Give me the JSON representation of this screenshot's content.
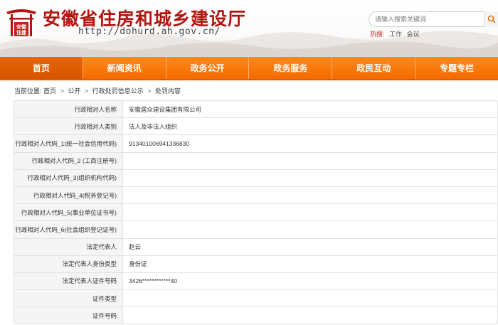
{
  "header": {
    "logo_text": "安徽住建",
    "title": "安徽省住房和城乡建设厅",
    "url": "http://dohurd.ah.gov.cn/",
    "search_placeholder": "请输入搜索关键词",
    "hot_label": "热搜:",
    "hot_words": [
      "工作",
      "会议"
    ]
  },
  "nav": {
    "items": [
      "首页",
      "新闻资讯",
      "政务公开",
      "政务服务",
      "政民互动",
      "专题专栏"
    ],
    "active_index": 0
  },
  "breadcrumb": {
    "prefix": "当前位置:",
    "items": [
      "首页",
      "公开",
      "行政处罚信息公示",
      "处罚内容"
    ],
    "separator": ">"
  },
  "table": {
    "rows": [
      {
        "label": "行政相对人名称",
        "value": "安徽居众建设集团有限公司"
      },
      {
        "label": "行政相对人类别",
        "value": "法人及非法人组织"
      },
      {
        "label": "行政相对人代码_1(统一社会信用代码)",
        "value": "913401006941336830"
      },
      {
        "label": "行政相对人代码_2 (工商注册号)",
        "value": ""
      },
      {
        "label": "行政相对人代码_3(组织机构代码)",
        "value": ""
      },
      {
        "label": "行政相对人代码_4(税务登记号)",
        "value": ""
      },
      {
        "label": "行政相对人代码_5(事业单位证书号)",
        "value": ""
      },
      {
        "label": "行政相对人代码_6(社会组织登记证号)",
        "value": ""
      },
      {
        "label": "法定代表人",
        "value": "赵云"
      },
      {
        "label": "法定代表人身份类型",
        "value": "身份证"
      },
      {
        "label": "法定代表人证件号码",
        "value": "3426************40"
      },
      {
        "label": "证件类型",
        "value": ""
      },
      {
        "label": "证件号码",
        "value": ""
      }
    ]
  },
  "colors": {
    "title_red": "#b4140f",
    "nav_orange": "#f26a00",
    "nav_active": "#d65500",
    "label_bg": "#f5f5f5"
  }
}
